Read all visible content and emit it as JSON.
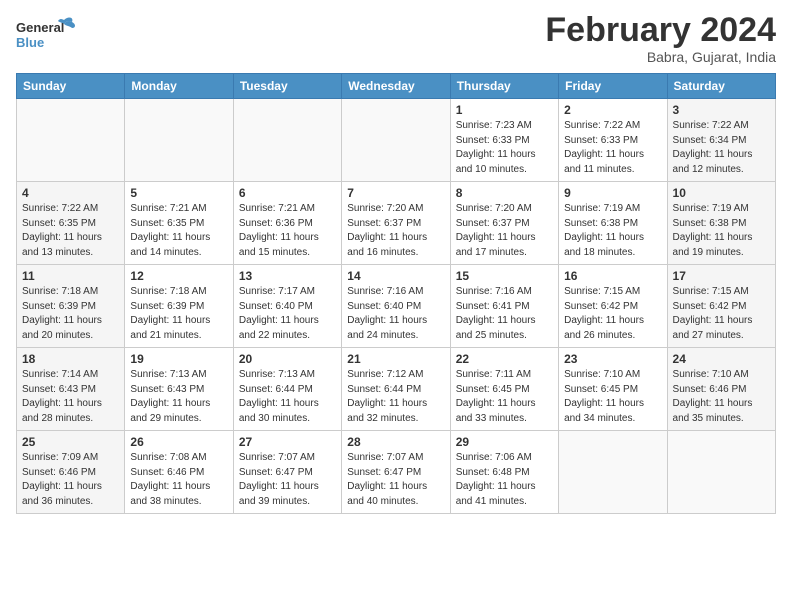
{
  "header": {
    "logo_general": "General",
    "logo_blue": "Blue",
    "month_title": "February 2024",
    "location": "Babra, Gujarat, India"
  },
  "weekdays": [
    "Sunday",
    "Monday",
    "Tuesday",
    "Wednesday",
    "Thursday",
    "Friday",
    "Saturday"
  ],
  "weeks": [
    [
      {
        "day": "",
        "sunrise": "",
        "sunset": "",
        "daylight": ""
      },
      {
        "day": "",
        "sunrise": "",
        "sunset": "",
        "daylight": ""
      },
      {
        "day": "",
        "sunrise": "",
        "sunset": "",
        "daylight": ""
      },
      {
        "day": "",
        "sunrise": "",
        "sunset": "",
        "daylight": ""
      },
      {
        "day": "1",
        "sunrise": "Sunrise: 7:23 AM",
        "sunset": "Sunset: 6:33 PM",
        "daylight": "Daylight: 11 hours and 10 minutes."
      },
      {
        "day": "2",
        "sunrise": "Sunrise: 7:22 AM",
        "sunset": "Sunset: 6:33 PM",
        "daylight": "Daylight: 11 hours and 11 minutes."
      },
      {
        "day": "3",
        "sunrise": "Sunrise: 7:22 AM",
        "sunset": "Sunset: 6:34 PM",
        "daylight": "Daylight: 11 hours and 12 minutes."
      }
    ],
    [
      {
        "day": "4",
        "sunrise": "Sunrise: 7:22 AM",
        "sunset": "Sunset: 6:35 PM",
        "daylight": "Daylight: 11 hours and 13 minutes."
      },
      {
        "day": "5",
        "sunrise": "Sunrise: 7:21 AM",
        "sunset": "Sunset: 6:35 PM",
        "daylight": "Daylight: 11 hours and 14 minutes."
      },
      {
        "day": "6",
        "sunrise": "Sunrise: 7:21 AM",
        "sunset": "Sunset: 6:36 PM",
        "daylight": "Daylight: 11 hours and 15 minutes."
      },
      {
        "day": "7",
        "sunrise": "Sunrise: 7:20 AM",
        "sunset": "Sunset: 6:37 PM",
        "daylight": "Daylight: 11 hours and 16 minutes."
      },
      {
        "day": "8",
        "sunrise": "Sunrise: 7:20 AM",
        "sunset": "Sunset: 6:37 PM",
        "daylight": "Daylight: 11 hours and 17 minutes."
      },
      {
        "day": "9",
        "sunrise": "Sunrise: 7:19 AM",
        "sunset": "Sunset: 6:38 PM",
        "daylight": "Daylight: 11 hours and 18 minutes."
      },
      {
        "day": "10",
        "sunrise": "Sunrise: 7:19 AM",
        "sunset": "Sunset: 6:38 PM",
        "daylight": "Daylight: 11 hours and 19 minutes."
      }
    ],
    [
      {
        "day": "11",
        "sunrise": "Sunrise: 7:18 AM",
        "sunset": "Sunset: 6:39 PM",
        "daylight": "Daylight: 11 hours and 20 minutes."
      },
      {
        "day": "12",
        "sunrise": "Sunrise: 7:18 AM",
        "sunset": "Sunset: 6:39 PM",
        "daylight": "Daylight: 11 hours and 21 minutes."
      },
      {
        "day": "13",
        "sunrise": "Sunrise: 7:17 AM",
        "sunset": "Sunset: 6:40 PM",
        "daylight": "Daylight: 11 hours and 22 minutes."
      },
      {
        "day": "14",
        "sunrise": "Sunrise: 7:16 AM",
        "sunset": "Sunset: 6:40 PM",
        "daylight": "Daylight: 11 hours and 24 minutes."
      },
      {
        "day": "15",
        "sunrise": "Sunrise: 7:16 AM",
        "sunset": "Sunset: 6:41 PM",
        "daylight": "Daylight: 11 hours and 25 minutes."
      },
      {
        "day": "16",
        "sunrise": "Sunrise: 7:15 AM",
        "sunset": "Sunset: 6:42 PM",
        "daylight": "Daylight: 11 hours and 26 minutes."
      },
      {
        "day": "17",
        "sunrise": "Sunrise: 7:15 AM",
        "sunset": "Sunset: 6:42 PM",
        "daylight": "Daylight: 11 hours and 27 minutes."
      }
    ],
    [
      {
        "day": "18",
        "sunrise": "Sunrise: 7:14 AM",
        "sunset": "Sunset: 6:43 PM",
        "daylight": "Daylight: 11 hours and 28 minutes."
      },
      {
        "day": "19",
        "sunrise": "Sunrise: 7:13 AM",
        "sunset": "Sunset: 6:43 PM",
        "daylight": "Daylight: 11 hours and 29 minutes."
      },
      {
        "day": "20",
        "sunrise": "Sunrise: 7:13 AM",
        "sunset": "Sunset: 6:44 PM",
        "daylight": "Daylight: 11 hours and 30 minutes."
      },
      {
        "day": "21",
        "sunrise": "Sunrise: 7:12 AM",
        "sunset": "Sunset: 6:44 PM",
        "daylight": "Daylight: 11 hours and 32 minutes."
      },
      {
        "day": "22",
        "sunrise": "Sunrise: 7:11 AM",
        "sunset": "Sunset: 6:45 PM",
        "daylight": "Daylight: 11 hours and 33 minutes."
      },
      {
        "day": "23",
        "sunrise": "Sunrise: 7:10 AM",
        "sunset": "Sunset: 6:45 PM",
        "daylight": "Daylight: 11 hours and 34 minutes."
      },
      {
        "day": "24",
        "sunrise": "Sunrise: 7:10 AM",
        "sunset": "Sunset: 6:46 PM",
        "daylight": "Daylight: 11 hours and 35 minutes."
      }
    ],
    [
      {
        "day": "25",
        "sunrise": "Sunrise: 7:09 AM",
        "sunset": "Sunset: 6:46 PM",
        "daylight": "Daylight: 11 hours and 36 minutes."
      },
      {
        "day": "26",
        "sunrise": "Sunrise: 7:08 AM",
        "sunset": "Sunset: 6:46 PM",
        "daylight": "Daylight: 11 hours and 38 minutes."
      },
      {
        "day": "27",
        "sunrise": "Sunrise: 7:07 AM",
        "sunset": "Sunset: 6:47 PM",
        "daylight": "Daylight: 11 hours and 39 minutes."
      },
      {
        "day": "28",
        "sunrise": "Sunrise: 7:07 AM",
        "sunset": "Sunset: 6:47 PM",
        "daylight": "Daylight: 11 hours and 40 minutes."
      },
      {
        "day": "29",
        "sunrise": "Sunrise: 7:06 AM",
        "sunset": "Sunset: 6:48 PM",
        "daylight": "Daylight: 11 hours and 41 minutes."
      },
      {
        "day": "",
        "sunrise": "",
        "sunset": "",
        "daylight": ""
      },
      {
        "day": "",
        "sunrise": "",
        "sunset": "",
        "daylight": ""
      }
    ]
  ]
}
